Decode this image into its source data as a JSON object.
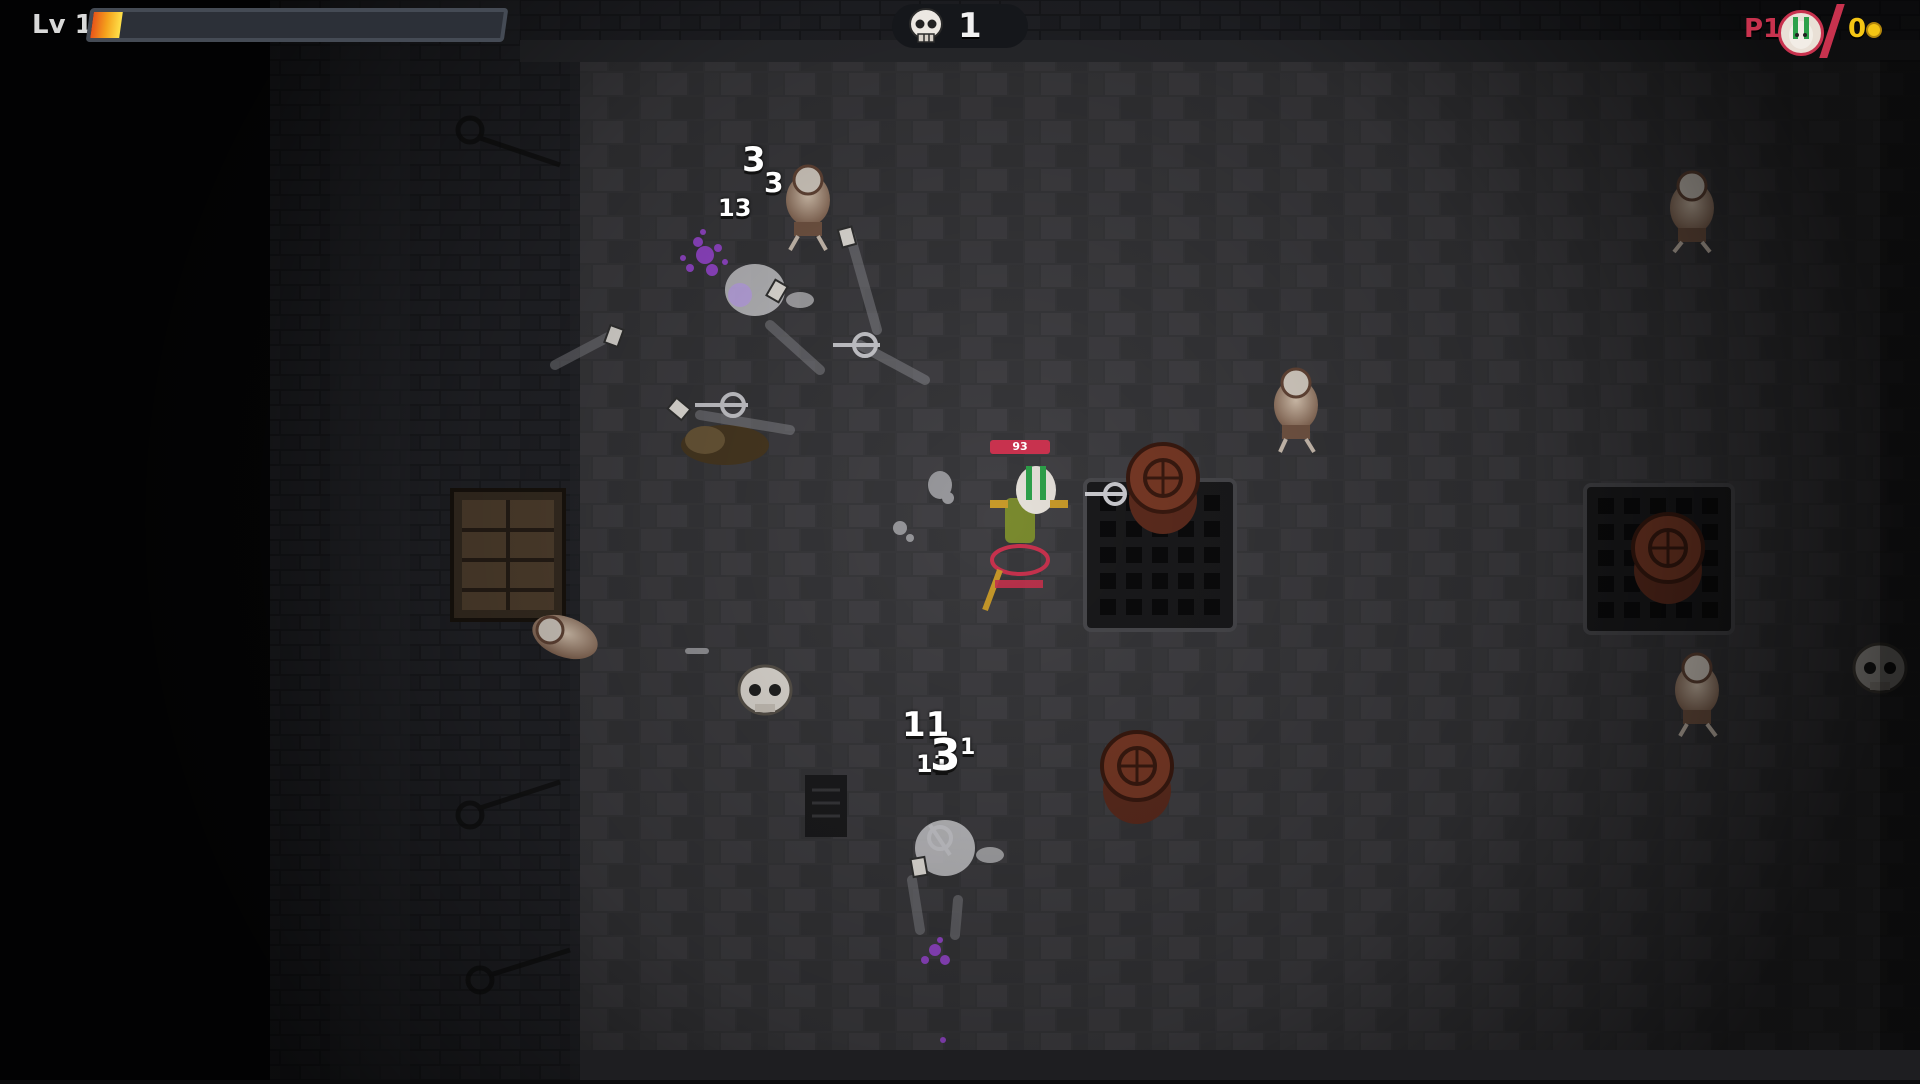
{
  "hud": {
    "level_label": "Lv 1",
    "xp_fraction": 0.07,
    "kill_count": "1",
    "player_label": "P1",
    "gold_count": "0",
    "player_hp": "93"
  },
  "damage_numbers": [
    "3",
    "3",
    "13",
    "11",
    "11",
    "3",
    "1"
  ],
  "colors": {
    "player_accent": "#c8324e",
    "gold": "#f4c514",
    "xp_fill": "#f4a11c"
  }
}
